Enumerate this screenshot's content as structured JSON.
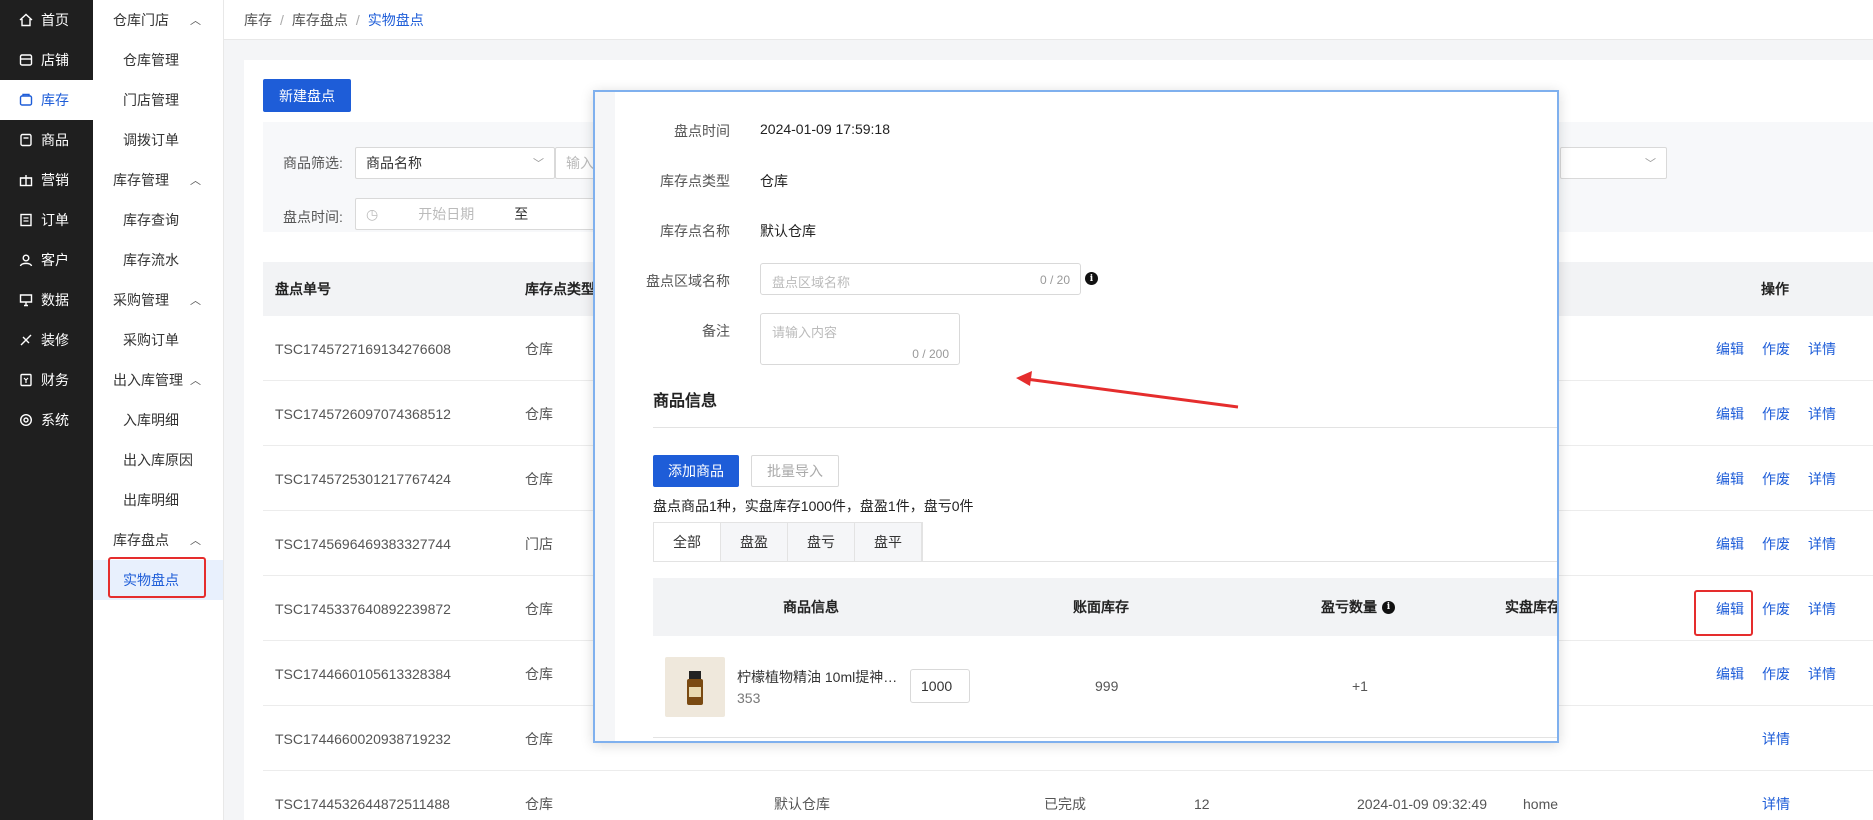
{
  "nav_primary": [
    {
      "label": "首页",
      "icon": "home-icon"
    },
    {
      "label": "店铺",
      "icon": "store-icon"
    },
    {
      "label": "库存",
      "icon": "inventory-icon",
      "active": true
    },
    {
      "label": "商品",
      "icon": "goods-icon"
    },
    {
      "label": "营销",
      "icon": "gift-icon"
    },
    {
      "label": "订单",
      "icon": "order-icon"
    },
    {
      "label": "客户",
      "icon": "customer-icon"
    },
    {
      "label": "数据",
      "icon": "data-icon"
    },
    {
      "label": "装修",
      "icon": "decorate-icon"
    },
    {
      "label": "财务",
      "icon": "finance-icon"
    },
    {
      "label": "系统",
      "icon": "settings-icon"
    }
  ],
  "nav_secondary": {
    "groups": [
      {
        "label": "仓库门店",
        "items": [
          "仓库管理",
          "门店管理",
          "调拨订单"
        ]
      },
      {
        "label": "库存管理",
        "items": [
          "库存查询",
          "库存流水"
        ]
      },
      {
        "label": "采购管理",
        "items": [
          "采购订单"
        ]
      },
      {
        "label": "出入库管理",
        "items": [
          "入库明细",
          "出入库原因",
          "出库明细"
        ]
      },
      {
        "label": "库存盘点",
        "items": [
          "实物盘点"
        ]
      }
    ],
    "active_item": "实物盘点"
  },
  "breadcrumb": [
    "库存",
    "库存盘点",
    "实物盘点"
  ],
  "toolbar": {
    "new_label": "新建盘点"
  },
  "filters": {
    "goods_label": "商品筛选:",
    "goods_select": "商品名称",
    "goods_input_placeholder": "输入",
    "time_label": "盘点时间:",
    "start_placeholder": "开始日期",
    "to_label": "至"
  },
  "table": {
    "headers": {
      "no": "盘点单号",
      "type": "库存点类型",
      "action": "操作"
    },
    "rows": [
      {
        "no": "TSC1745727169134276608",
        "type": "仓库",
        "actions": [
          "编辑",
          "作废",
          "详情"
        ]
      },
      {
        "no": "TSC1745726097074368512",
        "type": "仓库",
        "actions": [
          "编辑",
          "作废",
          "详情"
        ]
      },
      {
        "no": "TSC1745725301217767424",
        "type": "仓库",
        "actions": [
          "编辑",
          "作废",
          "详情"
        ]
      },
      {
        "no": "TSC1745696469383327744",
        "type": "门店",
        "actions": [
          "编辑",
          "作废",
          "详情"
        ]
      },
      {
        "no": "TSC1745337640892239872",
        "type": "仓库",
        "actions": [
          "编辑",
          "作废",
          "详情"
        ]
      },
      {
        "no": "TSC1744660105613328384",
        "type": "仓库",
        "actions": [
          "编辑",
          "作废",
          "详情"
        ]
      },
      {
        "no": "TSC1744660020938719232",
        "type": "仓库",
        "actions": [
          "详情"
        ]
      },
      {
        "no": "TSC1744532644872511488",
        "type": "仓库",
        "name": "默认仓库",
        "status": "已完成",
        "qty": "12",
        "time": "2024-01-09 09:32:49",
        "user": "home",
        "actions": [
          "详情"
        ]
      }
    ]
  },
  "modal": {
    "time_label": "盘点时间",
    "time_value": "2024-01-09 17:59:18",
    "type_label": "库存点类型",
    "type_value": "仓库",
    "name_label": "库存点名称",
    "name_value": "默认仓库",
    "area_label": "盘点区域名称",
    "area_placeholder": "盘点区域名称",
    "area_count": "0 / 20",
    "remark_label": "备注",
    "remark_placeholder": "请输入内容",
    "remark_count": "0 / 200",
    "section_title": "商品信息",
    "add_button": "添加商品",
    "import_button": "批量导入",
    "summary": "盘点商品1种，实盘库存1000件，盘盈1件，盘亏0件",
    "tabs": [
      "全部",
      "盘盈",
      "盘亏",
      "盘平"
    ],
    "table_headers": {
      "info": "商品信息",
      "book": "账面库存",
      "diff": "盈亏数量",
      "actual": "实盘库存"
    },
    "product": {
      "name": "柠檬植物精油 10ml提神…",
      "code": "353",
      "book": "999",
      "diff": "+1",
      "actual": "1000"
    }
  },
  "colors": {
    "primary": "#1e5dd8",
    "sidebar": "#1f1f1f",
    "highlight": "#e52d2d"
  }
}
